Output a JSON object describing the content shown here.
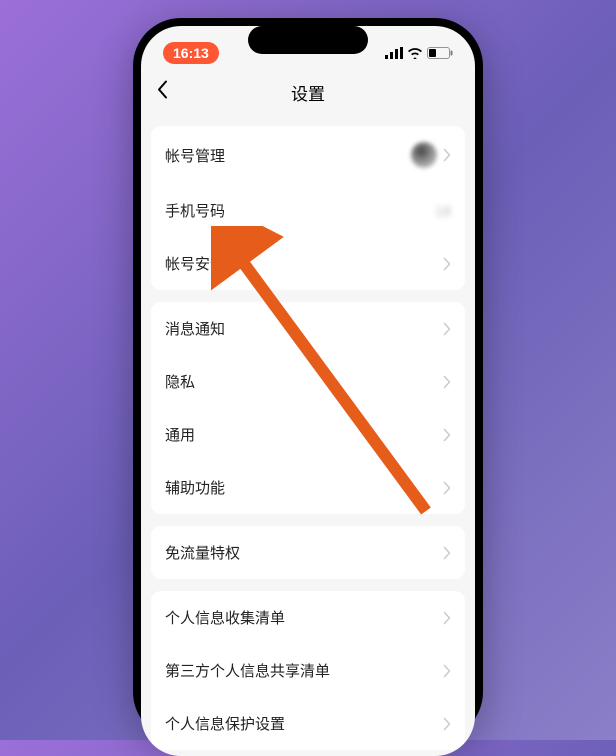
{
  "status": {
    "time": "16:13"
  },
  "nav": {
    "title": "设置"
  },
  "groups": [
    {
      "rows": [
        {
          "label": "帐号管理",
          "has_avatar": true,
          "has_chevron": true,
          "name": "row-account-management"
        },
        {
          "label": "手机号码",
          "value": "18",
          "has_chevron": false,
          "name": "row-phone-number"
        },
        {
          "label": "帐号安全",
          "has_chevron": true,
          "name": "row-account-security"
        }
      ]
    },
    {
      "rows": [
        {
          "label": "消息通知",
          "has_chevron": true,
          "name": "row-notifications"
        },
        {
          "label": "隐私",
          "has_chevron": true,
          "name": "row-privacy"
        },
        {
          "label": "通用",
          "has_chevron": true,
          "name": "row-general"
        },
        {
          "label": "辅助功能",
          "has_chevron": true,
          "name": "row-accessibility"
        }
      ]
    },
    {
      "rows": [
        {
          "label": "免流量特权",
          "has_chevron": true,
          "name": "row-data-free"
        }
      ]
    },
    {
      "rows": [
        {
          "label": "个人信息收集清单",
          "has_chevron": true,
          "name": "row-info-collection"
        },
        {
          "label": "第三方个人信息共享清单",
          "has_chevron": true,
          "name": "row-third-party-share"
        },
        {
          "label": "个人信息保护设置",
          "has_chevron": true,
          "name": "row-info-protection"
        }
      ]
    }
  ]
}
